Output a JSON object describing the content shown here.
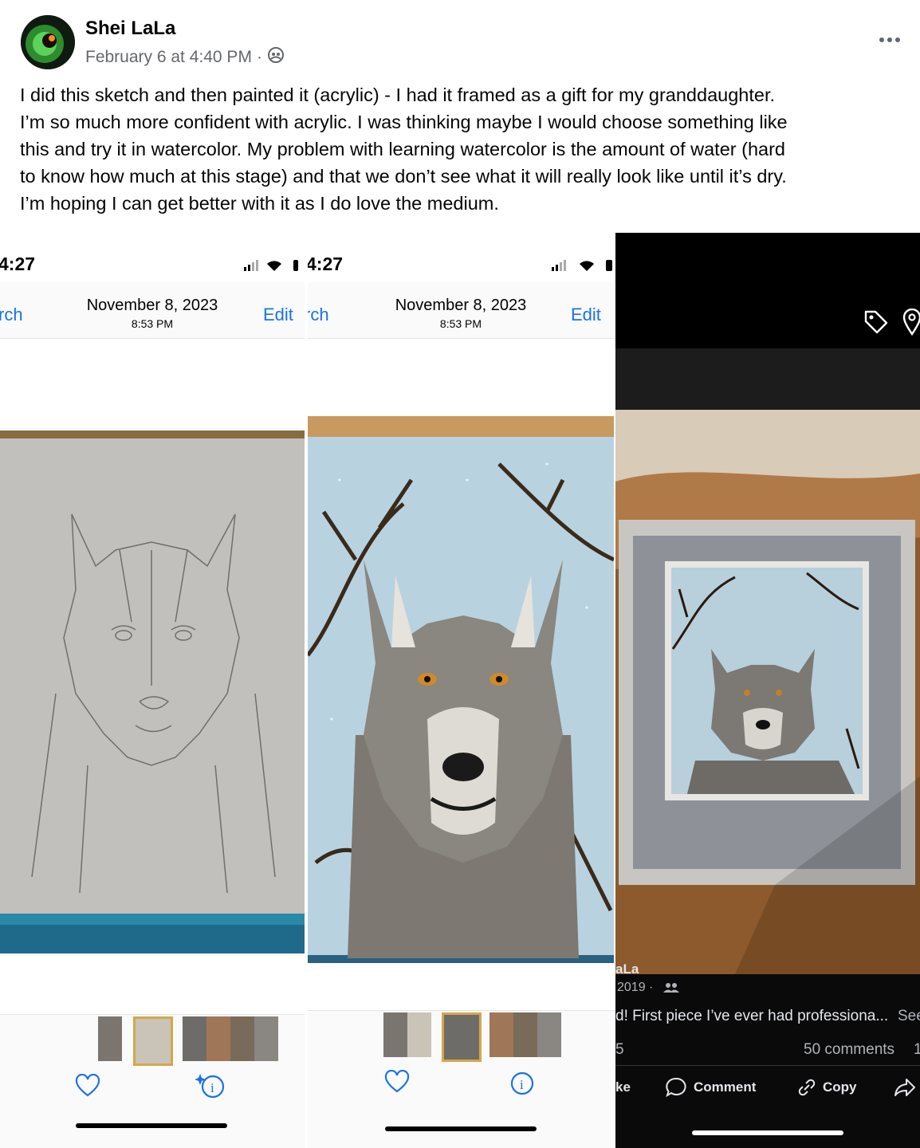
{
  "post": {
    "author": "Shei LaLa",
    "timestamp": "February 6 at 4:40 PM",
    "separator": "·",
    "caption": [
      "I did this sketch and then painted it (acrylic) - I had it framed as a gift for my granddaughter.",
      "I’m so much more confident with acrylic. I was thinking maybe I would choose something like",
      "this and try it in watercolor. My problem with learning watercolor is the amount of water (hard",
      "to know how much at this stage) and that we don’t see what it will really look like until it’s dry.",
      "I’m hoping I can get better with it as I do love the medium."
    ]
  },
  "panel1": {
    "time": "4:27",
    "back": "rch",
    "date": "November 8, 2023",
    "clock": "8:53 PM",
    "edit": "Edit"
  },
  "panel2": {
    "time": "4:27",
    "back": "rch",
    "date": "November 8, 2023",
    "clock": "8:53 PM",
    "edit": "Edit"
  },
  "panel3": {
    "name": "aLa",
    "date": "2019 ·",
    "text": "d! First piece I’ve ever had professiona...",
    "see": "See",
    "count_left": "5",
    "comments": "50 comments",
    "count_right": "1",
    "like": "ke",
    "comment": "Comment",
    "copy": "Copy"
  },
  "colors": {
    "link_blue": "#1a73e8",
    "text": "#050505",
    "muted": "#65676b"
  }
}
